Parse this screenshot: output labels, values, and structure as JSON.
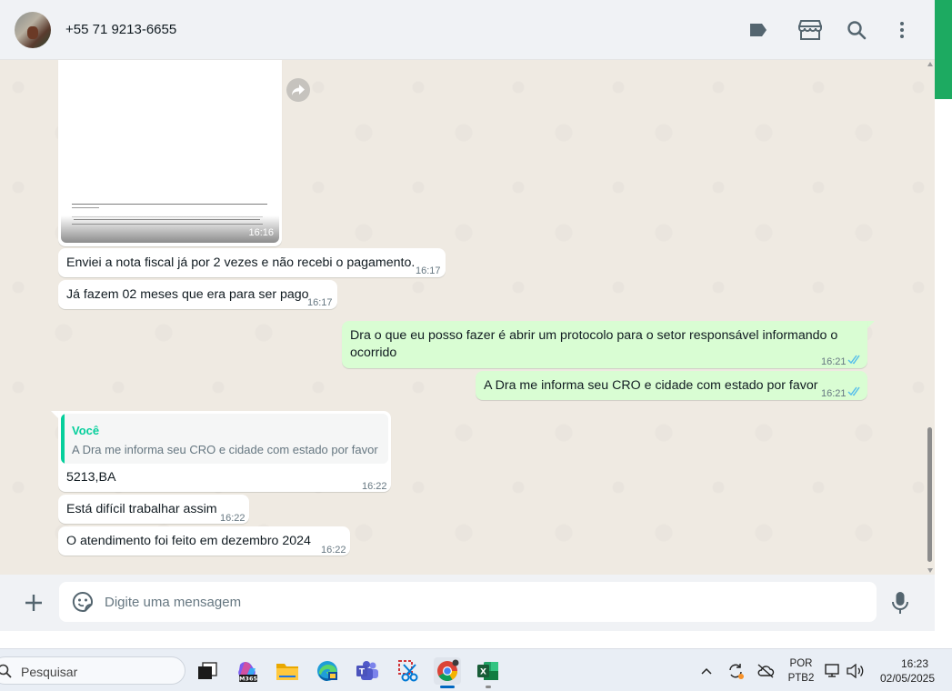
{
  "header": {
    "contact_name": "+55 71 9213-6655",
    "icons": [
      "label-icon",
      "shop-icon",
      "search-icon",
      "menu-icon"
    ]
  },
  "image_message": {
    "time": "16:16",
    "doc_caption": "IMPORTANTE: Este relatório contém valores brutos. Os valores serão alterados devido à dedução de impostos, porcentagens e taxas."
  },
  "messages": [
    {
      "id": "m1",
      "direction": "in",
      "text": "Enviei a nota fiscal já por 2 vezes e não recebi o pagamento.",
      "time": "16:17"
    },
    {
      "id": "m2",
      "direction": "in",
      "text": "Já fazem 02 meses que era para ser pago",
      "time": "16:17"
    },
    {
      "id": "m3",
      "direction": "out",
      "line1": "Dra o que eu posso fazer é abrir um protocolo para o setor responsável informando o",
      "line2": "ocorrido",
      "time": "16:21",
      "status": "read"
    },
    {
      "id": "m4",
      "direction": "out",
      "text": "A Dra me informa seu CRO e cidade com estado por favor",
      "time": "16:21",
      "status": "read"
    },
    {
      "id": "m5",
      "direction": "in",
      "quote_author": "Você",
      "quote_text": "A Dra me informa seu CRO e cidade com estado por favor",
      "text": "5213,BA",
      "time": "16:22"
    },
    {
      "id": "m6",
      "direction": "in",
      "text": "Está difícil trabalhar assim",
      "time": "16:22"
    },
    {
      "id": "m7",
      "direction": "in",
      "text": "O atendimento foi feito em dezembro 2024",
      "time": "16:22"
    }
  ],
  "composer": {
    "placeholder": "Digite uma mensagem"
  },
  "taskbar": {
    "search_label": "Pesquisar",
    "apps": [
      "task-view",
      "m365",
      "file-explorer",
      "edge",
      "teams",
      "snipping-tool",
      "chrome",
      "excel"
    ],
    "language": "POR",
    "keyboard": "PTB2",
    "time": "16:23",
    "date": "02/05/2025"
  },
  "colors": {
    "chat_bg": "#efeae2",
    "outgoing_bubble": "#d9fdd3",
    "incoming_bubble": "#ffffff",
    "read_ticks": "#53bdeb",
    "quote_accent": "#06cf9c",
    "brand_green": "#1daa61"
  }
}
